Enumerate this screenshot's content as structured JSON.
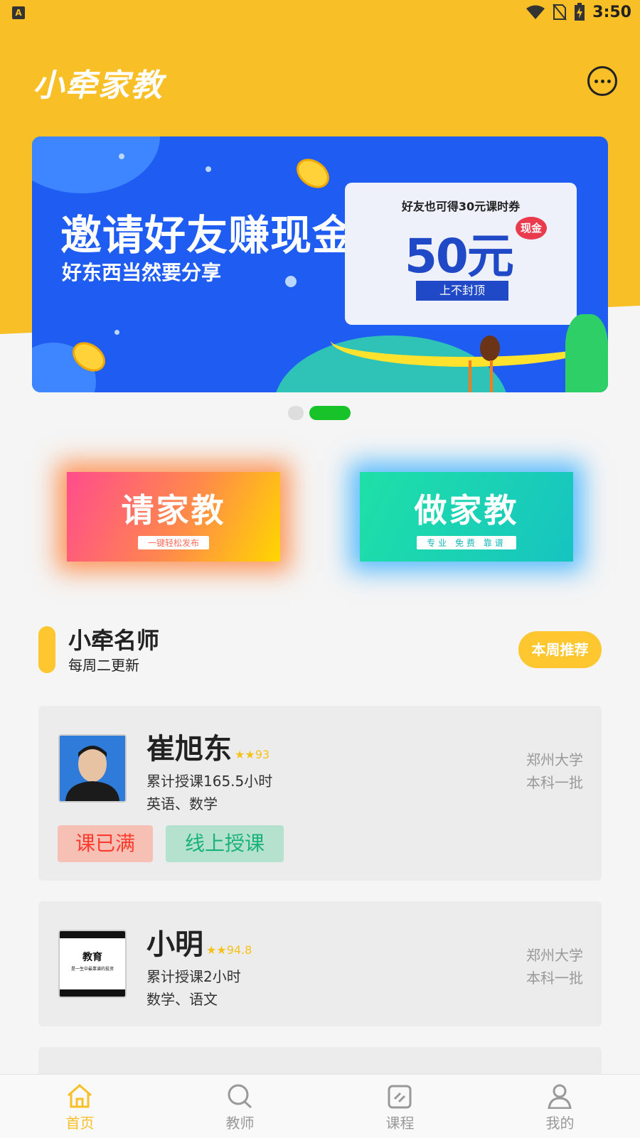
{
  "status_bar": {
    "time": "3:50"
  },
  "header": {
    "app_title": "小牵家教"
  },
  "banner": {
    "headline": "邀请好友赚现金",
    "subline": "好东西当然要分享",
    "card_title": "好友也可得30元课时券",
    "amount": "50元",
    "cash_badge": "现金",
    "no_cap": "上不封顶"
  },
  "actions": {
    "request_tutor": {
      "title": "请家教",
      "subtitle": "一键轻松发布"
    },
    "be_tutor": {
      "title": "做家教",
      "subtitle": "专业 免费 靠谱"
    }
  },
  "section": {
    "title": "小牵名师",
    "subtitle": "每周二更新",
    "weekly_button": "本周推荐"
  },
  "teachers": [
    {
      "name": "崔旭东",
      "rating": "★★93",
      "hours": "累计授课165.5小时",
      "subjects": "英语、数学",
      "school": "郑州大学",
      "level": "本科一批",
      "tags": [
        "课已满",
        "线上授课"
      ]
    },
    {
      "name": "小明",
      "rating": "★★94.8",
      "hours": "累计授课2小时",
      "subjects": "数学、语文",
      "school": "郑州大学",
      "level": "本科一批",
      "avatar_text_title": "教育",
      "avatar_text_line": "是一生中最靠谱的投资"
    }
  ],
  "bottom_nav": [
    {
      "label": "首页",
      "icon": "home-icon",
      "active": true
    },
    {
      "label": "教师",
      "icon": "search-icon",
      "active": false
    },
    {
      "label": "课程",
      "icon": "course-icon",
      "active": false
    },
    {
      "label": "我的",
      "icon": "profile-icon",
      "active": false
    }
  ],
  "colors": {
    "brand_yellow": "#f8bf26",
    "banner_blue": "#1f5cf2",
    "pager_active": "#18c32a",
    "tag_full_text": "#ff3a2f",
    "tag_online_text": "#1ab27a"
  }
}
